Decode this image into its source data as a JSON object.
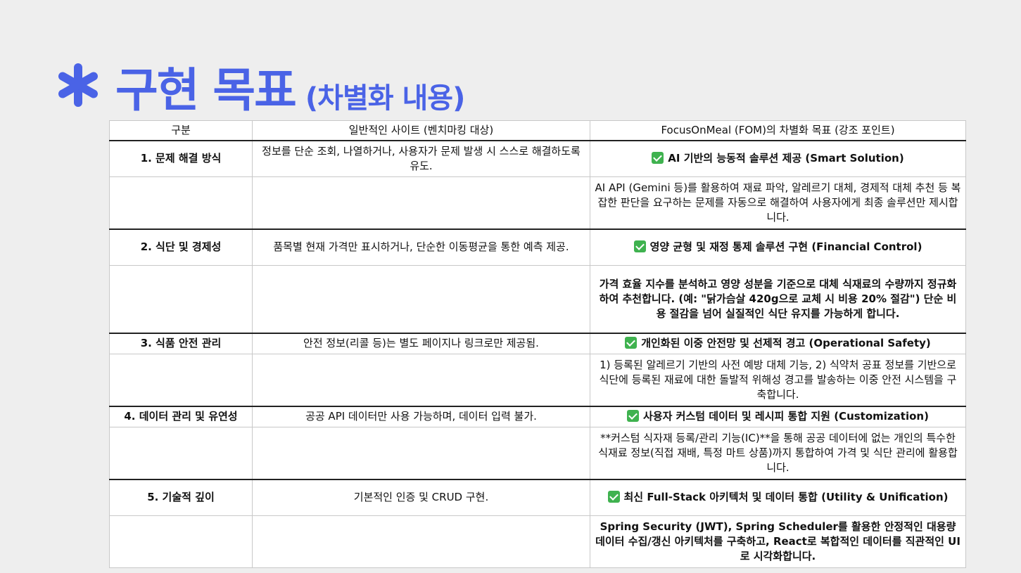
{
  "title": {
    "main": "구현 목표",
    "sub": "(차별화 내용)",
    "icon": "asterisk-icon",
    "color": "#4a63e6"
  },
  "table": {
    "headers": [
      "구분",
      "일반적인 사이트 (벤치마킹 대상)",
      "FocusOnMeal (FOM)의 차별화 목표 (강조 포인트)"
    ],
    "rows": [
      {
        "category": "1. 문제 해결 방식",
        "general": "정보를 단순 조회, 나열하거나, 사용자가 문제 발생 시 스스로 해결하도록 유도.",
        "goal": "AI 기반의 능동적 솔루션 제공 (Smart Solution)",
        "detail": "AI API (Gemini 등)를 활용하여 재료 파악, 알레르기 대체, 경제적 대체 추천 등 복잡한 판단을 요구하는 문제를 자동으로 해결하여 사용자에게 최종 솔루션만 제시합니다."
      },
      {
        "category": "2. 식단 및 경제성",
        "general": "품목별 현재 가격만 표시하거나, 단순한 이동평균을 통한 예측 제공.",
        "goal": "영양 균형 및 재정 통제 솔루션 구현 (Financial Control)",
        "detail": "가격 효율 지수를 분석하고 영양 성분을 기준으로 대체 식재료의 수량까지 정규화하여 추천합니다. (예: \"닭가슴살 420g으로 교체 시 비용 20% 절감\") 단순 비용 절감을 넘어 실질적인 식단 유지를 가능하게 합니다."
      },
      {
        "category": "3. 식품 안전 관리",
        "general": "안전 정보(리콜 등)는 별도 페이지나 링크로만 제공됨.",
        "goal": "개인화된 이중 안전망 및 선제적 경고 (Operational Safety)",
        "detail": "1) 등록된 알레르기 기반의 사전 예방 대체 기능, 2) 식약처 공표 정보를 기반으로 식단에 등록된 재료에 대한 돌발적 위해성 경고를 발송하는 이중 안전 시스템을 구축합니다."
      },
      {
        "category": "4. 데이터 관리 및 유연성",
        "general": "공공 API 데이터만 사용 가능하며, 데이터 입력 불가.",
        "goal": "사용자 커스텀 데이터 및 레시피 통합 지원 (Customization)",
        "detail": "**커스텀 식자재 등록/관리 기능(IC)**을 통해 공공 데이터에 없는 개인의 특수한 식재료 정보(직접 재배, 특정 마트 상품)까지 통합하여 가격 및 식단 관리에 활용합니다."
      },
      {
        "category": "5. 기술적 깊이",
        "general": "기본적인 인증 및 CRUD 구현.",
        "goal": "최신 Full-Stack 아키텍처 및 데이터 통합 (Utility & Unification)",
        "detail": "Spring Security (JWT), Spring Scheduler를 활용한 안정적인 대용량 데이터 수집/갱신 아키텍처를 구축하고, React로 복합적인 데이터를 직관적인 UI로 시각화합니다."
      }
    ]
  },
  "colors": {
    "accent": "#4a63e6",
    "check": "#3fb24f"
  }
}
